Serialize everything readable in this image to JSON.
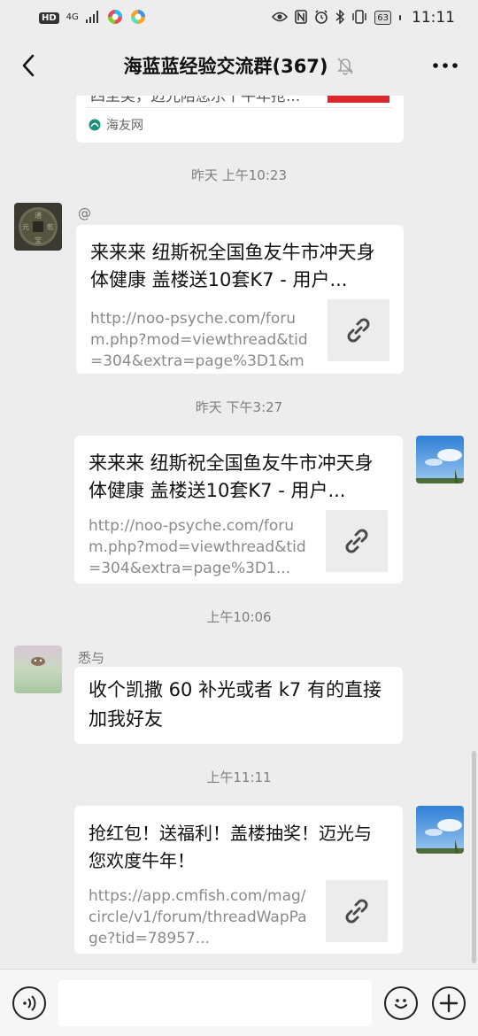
{
  "status_bar": {
    "badge": "HD",
    "network": "4G",
    "battery": "63",
    "time": "11:11"
  },
  "header": {
    "title": "海蓝蓝经验交流群(367)"
  },
  "top_card": {
    "partial_text": "四至奖，迈光陪您乐干牛年抢...",
    "source": "海友网"
  },
  "messages": [
    {
      "timestamp": "昨天 上午10:23",
      "sender": "@",
      "title": "来来来 纽斯祝全国鱼友牛市冲天身体健康 盖楼送10套K7 - 用户...",
      "url": "http://noo-psyche.com/forum.php?mod=viewthread&tid=304&extra=page%3D1&mo..."
    },
    {
      "timestamp": "昨天 下午3:27",
      "title": "来来来 纽斯祝全国鱼友牛市冲天身体健康 盖楼送10套K7 - 用户...",
      "url": "http://noo-psyche.com/forum.php?mod=viewthread&tid=304&extra=page%3D1..."
    },
    {
      "timestamp": "上午10:06",
      "sender": "悉与",
      "text": "收个凯撒 60 补光或者 k7 有的直接加我好友"
    },
    {
      "timestamp": "上午11:11",
      "title": "抢红包！送福利！盖楼抽奖！迈光与您欢度牛年！",
      "url": "https://app.cmfish.com/mag/circle/v1/forum/threadWapPage?tid=78957..."
    }
  ],
  "input": {
    "value": ""
  }
}
